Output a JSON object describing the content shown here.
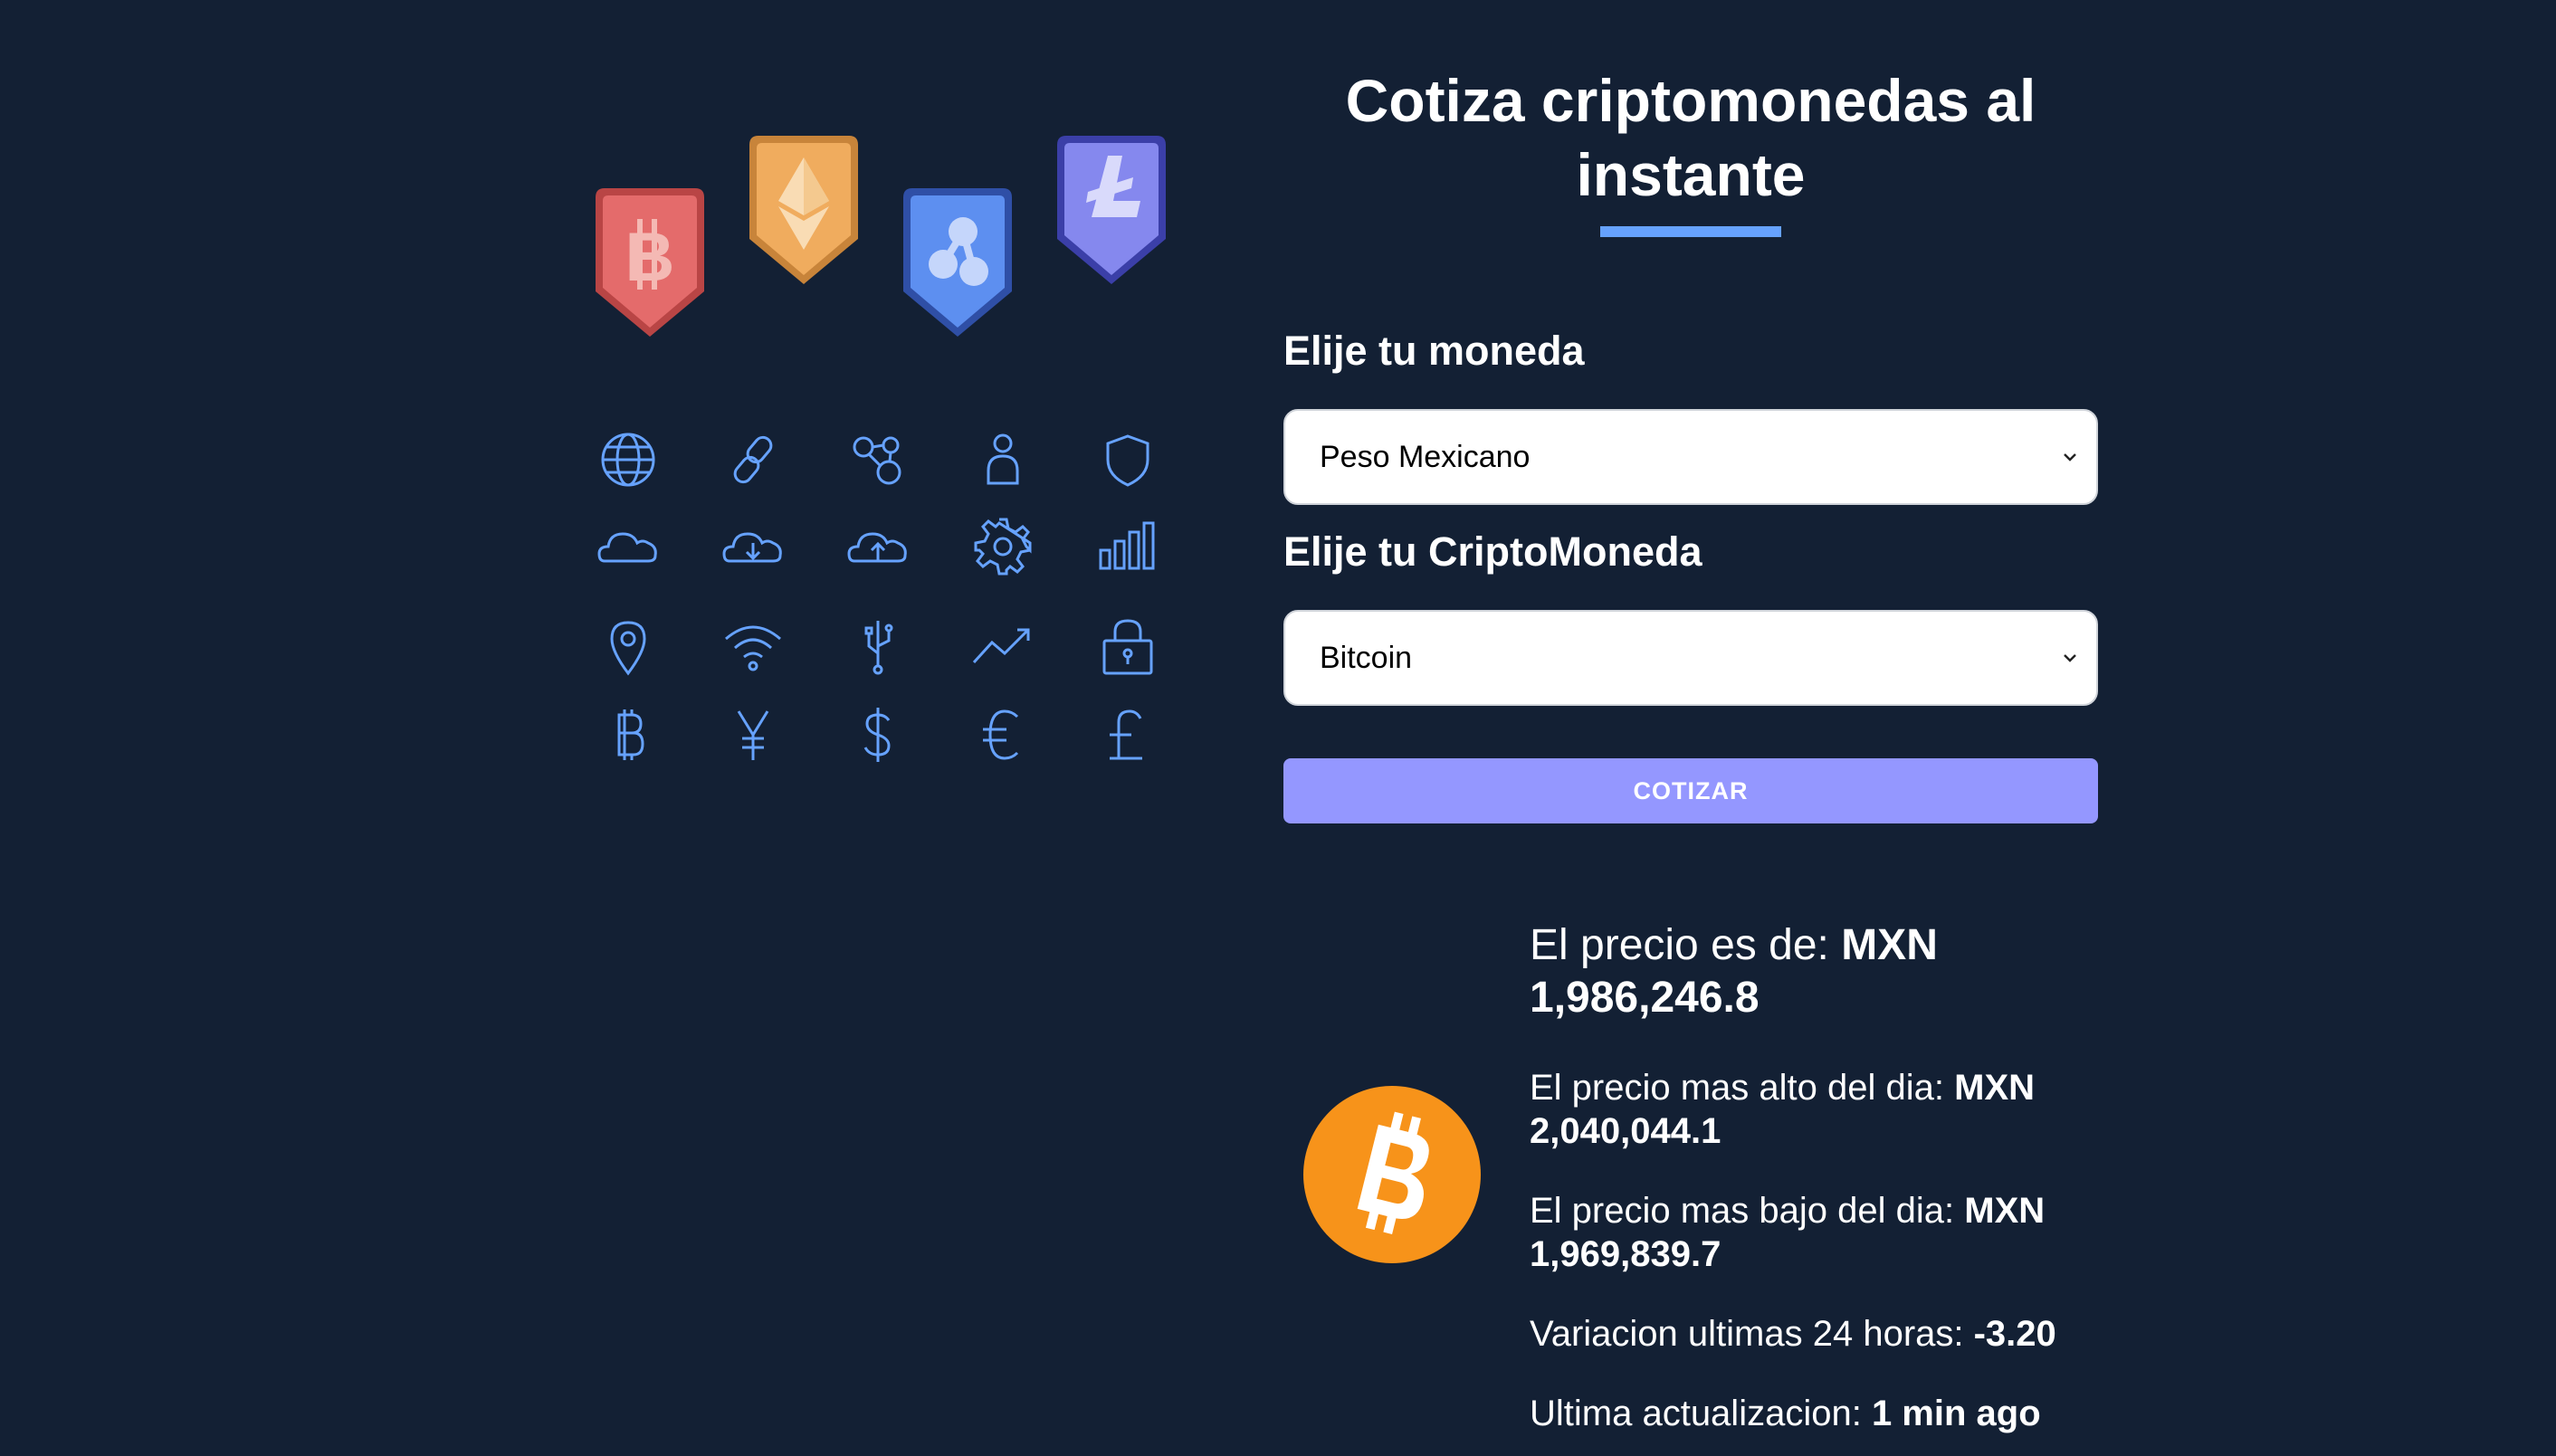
{
  "title": "Cotiza criptomonedas al instante",
  "currency_field": {
    "label": "Elije tu moneda",
    "selected": "Peso Mexicano"
  },
  "crypto_field": {
    "label": "Elije tu CriptoMoneda",
    "selected": "Bitcoin"
  },
  "submit_label": "COTIZAR",
  "result": {
    "price_label": "El precio es de: ",
    "price_value": "MXN 1,986,246.8",
    "high_label": "El precio mas alto del dia: ",
    "high_value": "MXN 2,040,044.1",
    "low_label": "El precio mas bajo del dia: ",
    "low_value": "MXN 1,969,839.7",
    "change_label": "Variacion ultimas 24 horas: ",
    "change_value": "-3.20",
    "updated_label": "Ultima actualizacion: ",
    "updated_value": "1 min ago"
  },
  "colors": {
    "background": "#132034",
    "accent": "#66a2fe",
    "button": "#9497ff",
    "icon_stroke": "#66a2fe",
    "bitcoin": "#f7931a"
  },
  "hero_badges": [
    "bitcoin-icon",
    "ethereum-icon",
    "ripple-icon",
    "litecoin-icon"
  ],
  "hero_icons": [
    "globe-icon",
    "link-icon",
    "network-icon",
    "user-icon",
    "shield-icon",
    "cloud-icon",
    "cloud-download-icon",
    "cloud-upload-icon",
    "gear-icon",
    "bar-chart-icon",
    "location-pin-icon",
    "wifi-icon",
    "usb-icon",
    "trend-up-icon",
    "lock-icon",
    "bitcoin-symbol-icon",
    "yen-icon",
    "dollar-icon",
    "euro-icon",
    "pound-icon"
  ]
}
